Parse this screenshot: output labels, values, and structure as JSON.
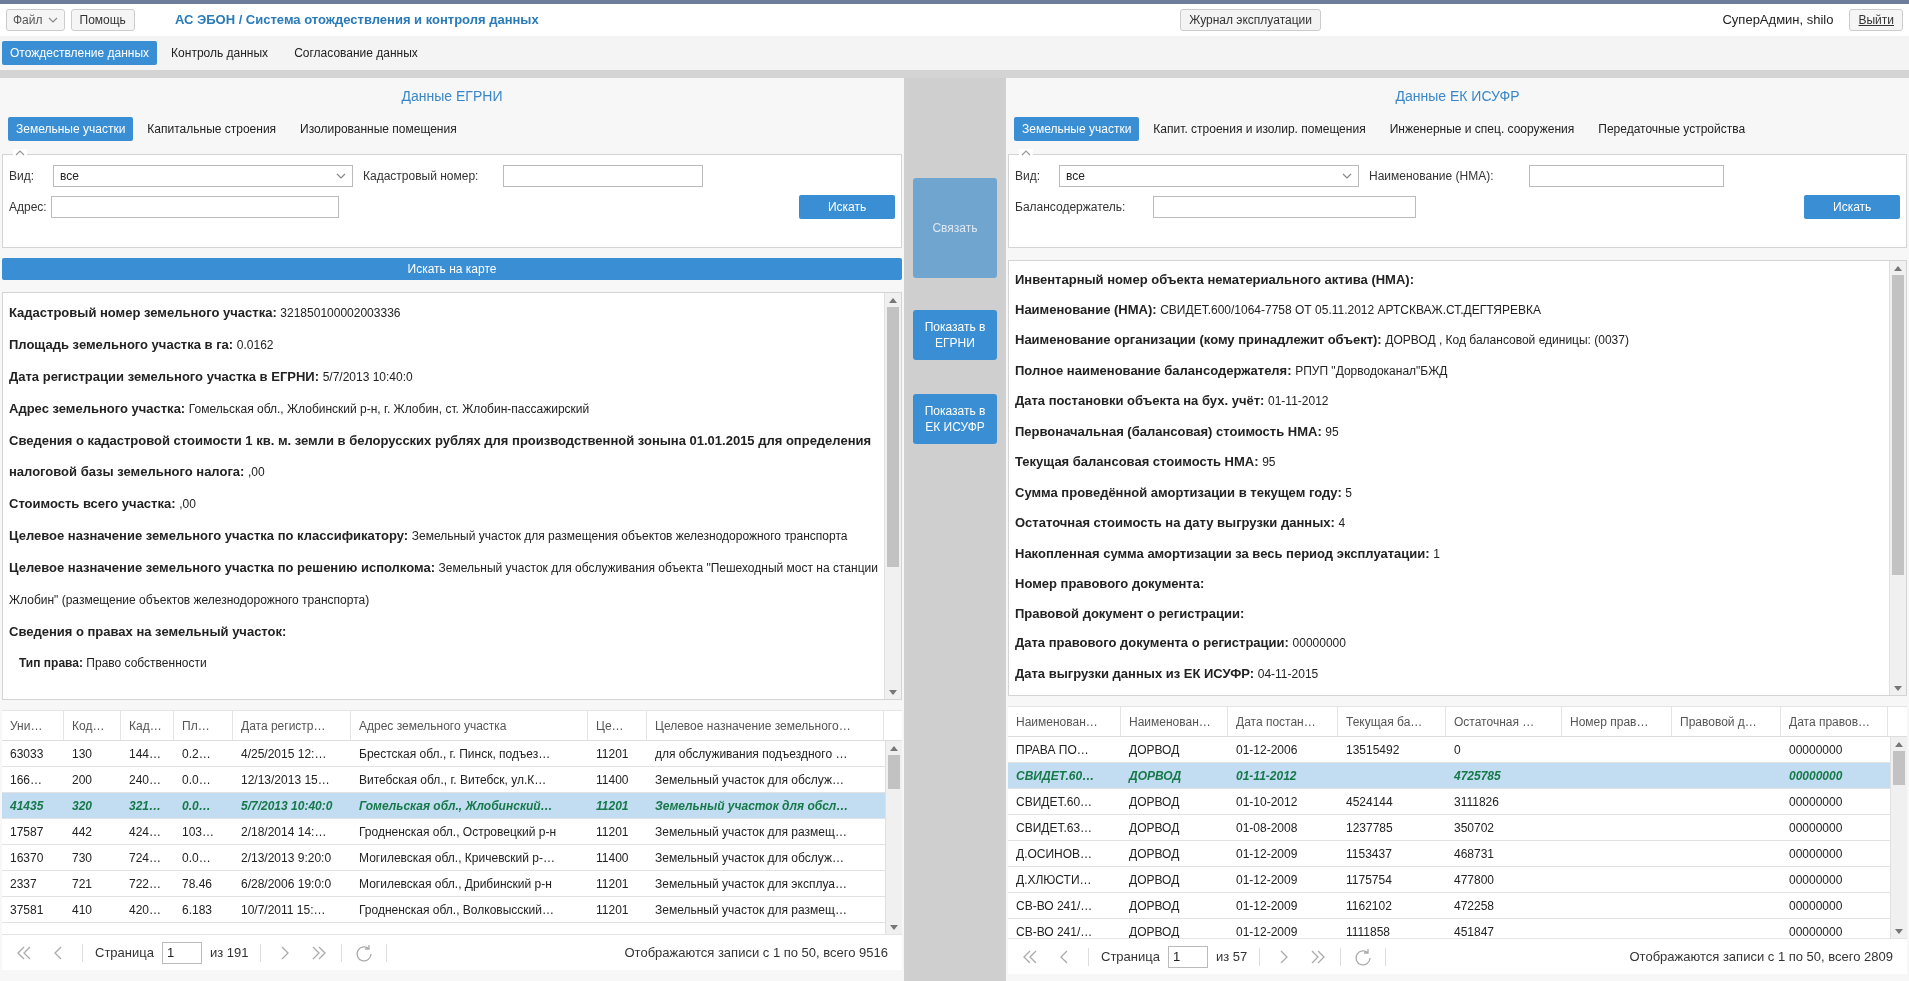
{
  "header": {
    "file_menu": "Файл",
    "help": "Помощь",
    "app_title": "АС ЭБОН / Система отождествления и контроля данных",
    "journal": "Журнал эксплуатации",
    "user": "СуперАдмин, shilo",
    "logout": "Выйти"
  },
  "nav_tabs": [
    {
      "label": "Отождествление данных",
      "selected": true
    },
    {
      "label": "Контроль данных",
      "selected": false
    },
    {
      "label": "Согласование данных",
      "selected": false
    }
  ],
  "left": {
    "title": "Данные ЕГРНИ",
    "tabs": [
      {
        "label": "Земельные участки",
        "selected": true
      },
      {
        "label": "Капитальные строения",
        "selected": false
      },
      {
        "label": "Изолированные помещения",
        "selected": false
      }
    ],
    "filters": {
      "type_label": "Вид:",
      "type_value": "все",
      "f2_label": "Кадастровый номер:",
      "f3_label": "Адрес:",
      "search": "Искать"
    },
    "map_button": "Искать на карте",
    "details": [
      {
        "kind": "line",
        "label": "Кадастровый номер земельного участка:",
        "value": "321850100002003336"
      },
      {
        "kind": "line",
        "label": "Площадь земельного участка в га:",
        "value": "0.0162"
      },
      {
        "kind": "line",
        "label": "Дата регистрации земельного участка в ЕГРНИ:",
        "value": "5/7/2013 10:40:0"
      },
      {
        "kind": "line",
        "label": "Адрес земельного участка:",
        "value": "Гомельская обл., Жлобинский р-н, г. Жлобин, ст. Жлобин-пассажирский"
      },
      {
        "kind": "line",
        "label": "Сведения о кадастровой стоимости 1 кв. м. земли в белорусских рублях для производственной зонына 01.01.2015 для определения налоговой базы земельного налога:",
        "value": ",00"
      },
      {
        "kind": "line",
        "label": "Стоимость всего участка:",
        "value": ",00"
      },
      {
        "kind": "line",
        "label": "Целевое назначение земельного участка по классификатору:",
        "value": "Земельный участок для размещения объектов железнодорожного транспорта"
      },
      {
        "kind": "line",
        "label": "Целевое назначение земельного участка по решению исполкома:",
        "value": "Земельный участок для обслуживания объекта \"Пешеходный мост на станции Жлобин\" (размещение объектов железнодорожного транспорта)"
      },
      {
        "kind": "line",
        "label": "Сведения о правах на земельный участок:"
      },
      {
        "kind": "sub",
        "label": "Тип права:",
        "value": "Право собственности"
      }
    ],
    "table": {
      "columns": [
        "Уни…",
        "Код…",
        "Кад…",
        "Пл…",
        "Дата регистр…",
        "Адрес земельного участка",
        "Це…",
        "Целевое назначение земельного…"
      ],
      "rows": [
        {
          "selected": false,
          "cells": [
            "63033",
            "130",
            "144…",
            "0.2…",
            "4/25/2015 12:…",
            "Брестская обл., г. Пинск, подъез…",
            "11201",
            "для обслуживания подъездного …"
          ]
        },
        {
          "selected": false,
          "cells": [
            "166…",
            "200",
            "240…",
            "0.0…",
            "12/13/2013 15…",
            "Витебская обл., г. Витебск, ул.К…",
            "11400",
            "Земельный участок для обслуж…"
          ]
        },
        {
          "selected": true,
          "cells": [
            "41435",
            "320",
            "321…",
            "0.0…",
            "5/7/2013 10:40:0",
            "Гомельская обл., Жлобинский…",
            "11201",
            "Земельный участок для обсл…"
          ]
        },
        {
          "selected": false,
          "cells": [
            "17587",
            "442",
            "424…",
            "103…",
            "2/18/2014 14:…",
            "Гродненская обл., Островецкий р-н",
            "11201",
            "Земельный участок для размещ…"
          ]
        },
        {
          "selected": false,
          "cells": [
            "16370",
            "730",
            "724…",
            "0.0…",
            "2/13/2013 9:20:0",
            "Могилевская обл., Кричевский р-…",
            "11400",
            "Земельный участок для обслуж…"
          ]
        },
        {
          "selected": false,
          "cells": [
            "2337",
            "721",
            "722…",
            "78.46",
            "6/28/2006 19:0:0",
            "Могилевская обл., Дрибинский р-н",
            "11201",
            "Земельный участок для эксплуа…"
          ]
        },
        {
          "selected": false,
          "cells": [
            "37581",
            "410",
            "420…",
            "6.183",
            "10/7/2011 15:…",
            "Гродненская обл., Волковысский…",
            "11201",
            "Земельный участок для размещ…"
          ]
        }
      ]
    },
    "pager": {
      "page_label": "Страница",
      "page": "1",
      "of": "из 191",
      "summary": "Отображаются записи с 1 по 50, всего 9516"
    }
  },
  "middle": {
    "link": {
      "label": "Связать",
      "disabled": true
    },
    "show_left": "Показать в ЕГРНИ",
    "show_right": "Показать в ЕК ИСУФР"
  },
  "right": {
    "title": "Данные ЕК ИСУФР",
    "tabs": [
      {
        "label": "Земельные участки",
        "selected": true
      },
      {
        "label": "Капит. строения и изолир. помещения",
        "selected": false
      },
      {
        "label": "Инженерные и спец. сооружения",
        "selected": false
      },
      {
        "label": "Передаточные устройства",
        "selected": false
      }
    ],
    "filters": {
      "type_label": "Вид:",
      "type_value": "все",
      "f2_label": "Наименование (НМА):",
      "f3_label": "Балансодержатель:",
      "search": "Искать"
    },
    "details": [
      {
        "kind": "line",
        "label": "Инвентарный номер объекта нематериального актива (НМА):"
      },
      {
        "kind": "line",
        "label": "Наименование (НМА):",
        "value": "СВИДЕТ.600/1064-7758 ОТ 05.11.2012 АРТСКВАЖ.СТ.ДЕГТЯРЕВКА"
      },
      {
        "kind": "line",
        "label": "Наименование организации (кому принадлежит объект):",
        "value": "ДОРВОД , Код балансовой единицы: (0037)"
      },
      {
        "kind": "line",
        "label": "Полное наименование балансодержателя:",
        "value": "РПУП \"Дорводоканал\"БЖД"
      },
      {
        "kind": "line",
        "label": "Дата постановки объекта на бух. учёт:",
        "value": "01-11-2012"
      },
      {
        "kind": "line",
        "label": "Первоначальная (балансовая) стоимость НМА:",
        "value": "95"
      },
      {
        "kind": "line",
        "label": "Текущая балансовая стоимость НМА:",
        "value": "95"
      },
      {
        "kind": "line",
        "label": "Сумма проведённой амортизации в текущем году:",
        "value": "5"
      },
      {
        "kind": "line",
        "label": "Остаточная стоимость на дату выгрузки данных:",
        "value": "4"
      },
      {
        "kind": "line",
        "label": "Накопленная сумма амортизации за весь период эксплуатации:",
        "value": "1"
      },
      {
        "kind": "line",
        "label": "Номер правового документа:"
      },
      {
        "kind": "line",
        "label": "Правовой документ о регистрации:"
      },
      {
        "kind": "line",
        "label": "Дата правового документа о регистрации:",
        "value": "00000000"
      },
      {
        "kind": "line",
        "label": "Дата выгрузки данных из ЕК ИСУФР:",
        "value": "04-11-2015"
      }
    ],
    "table": {
      "columns": [
        "Наименован…",
        "Наименован…",
        "Дата постан…",
        "Текущая ба…",
        "Остаточная …",
        "Номер прав…",
        "Правовой д…",
        "Дата правов…"
      ],
      "rows": [
        {
          "selected": false,
          "cells": [
            "ПРАВА ПО…",
            "ДОРВОД",
            "01-12-2006",
            "13515492",
            "0",
            null,
            null,
            "00000000"
          ]
        },
        {
          "selected": true,
          "cells": [
            "СВИДЕТ.60…",
            "ДОРВОД",
            "01-11-2012",
            null,
            "4725785",
            null,
            null,
            "00000000"
          ]
        },
        {
          "selected": false,
          "cells": [
            "СВИДЕТ.60…",
            "ДОРВОД",
            "01-10-2012",
            "4524144",
            "3111826",
            null,
            null,
            "00000000"
          ]
        },
        {
          "selected": false,
          "cells": [
            "СВИДЕТ.63…",
            "ДОРВОД",
            "01-08-2008",
            "1237785",
            "350702",
            null,
            null,
            "00000000"
          ]
        },
        {
          "selected": false,
          "cells": [
            "Д.ОСИНОВ…",
            "ДОРВОД",
            "01-12-2009",
            "1153437",
            "468731",
            null,
            null,
            "00000000"
          ]
        },
        {
          "selected": false,
          "cells": [
            "Д.ХЛЮСТИ…",
            "ДОРВОД",
            "01-12-2009",
            "1175754",
            "477800",
            null,
            null,
            "00000000"
          ]
        },
        {
          "selected": false,
          "cells": [
            "СВ-ВО 241/…",
            "ДОРВОД",
            "01-12-2009",
            "1162102",
            "472258",
            null,
            null,
            "00000000"
          ]
        },
        {
          "selected": false,
          "cells": [
            "СВ-ВО 241/…",
            "ДОРВОД",
            "01-12-2009",
            "1111858",
            "451847",
            null,
            null,
            "00000000"
          ]
        }
      ]
    },
    "pager": {
      "page_label": "Страница",
      "page": "1",
      "of": "из 57",
      "summary": "Отображаются записи с 1 по 50, всего 2809"
    }
  }
}
